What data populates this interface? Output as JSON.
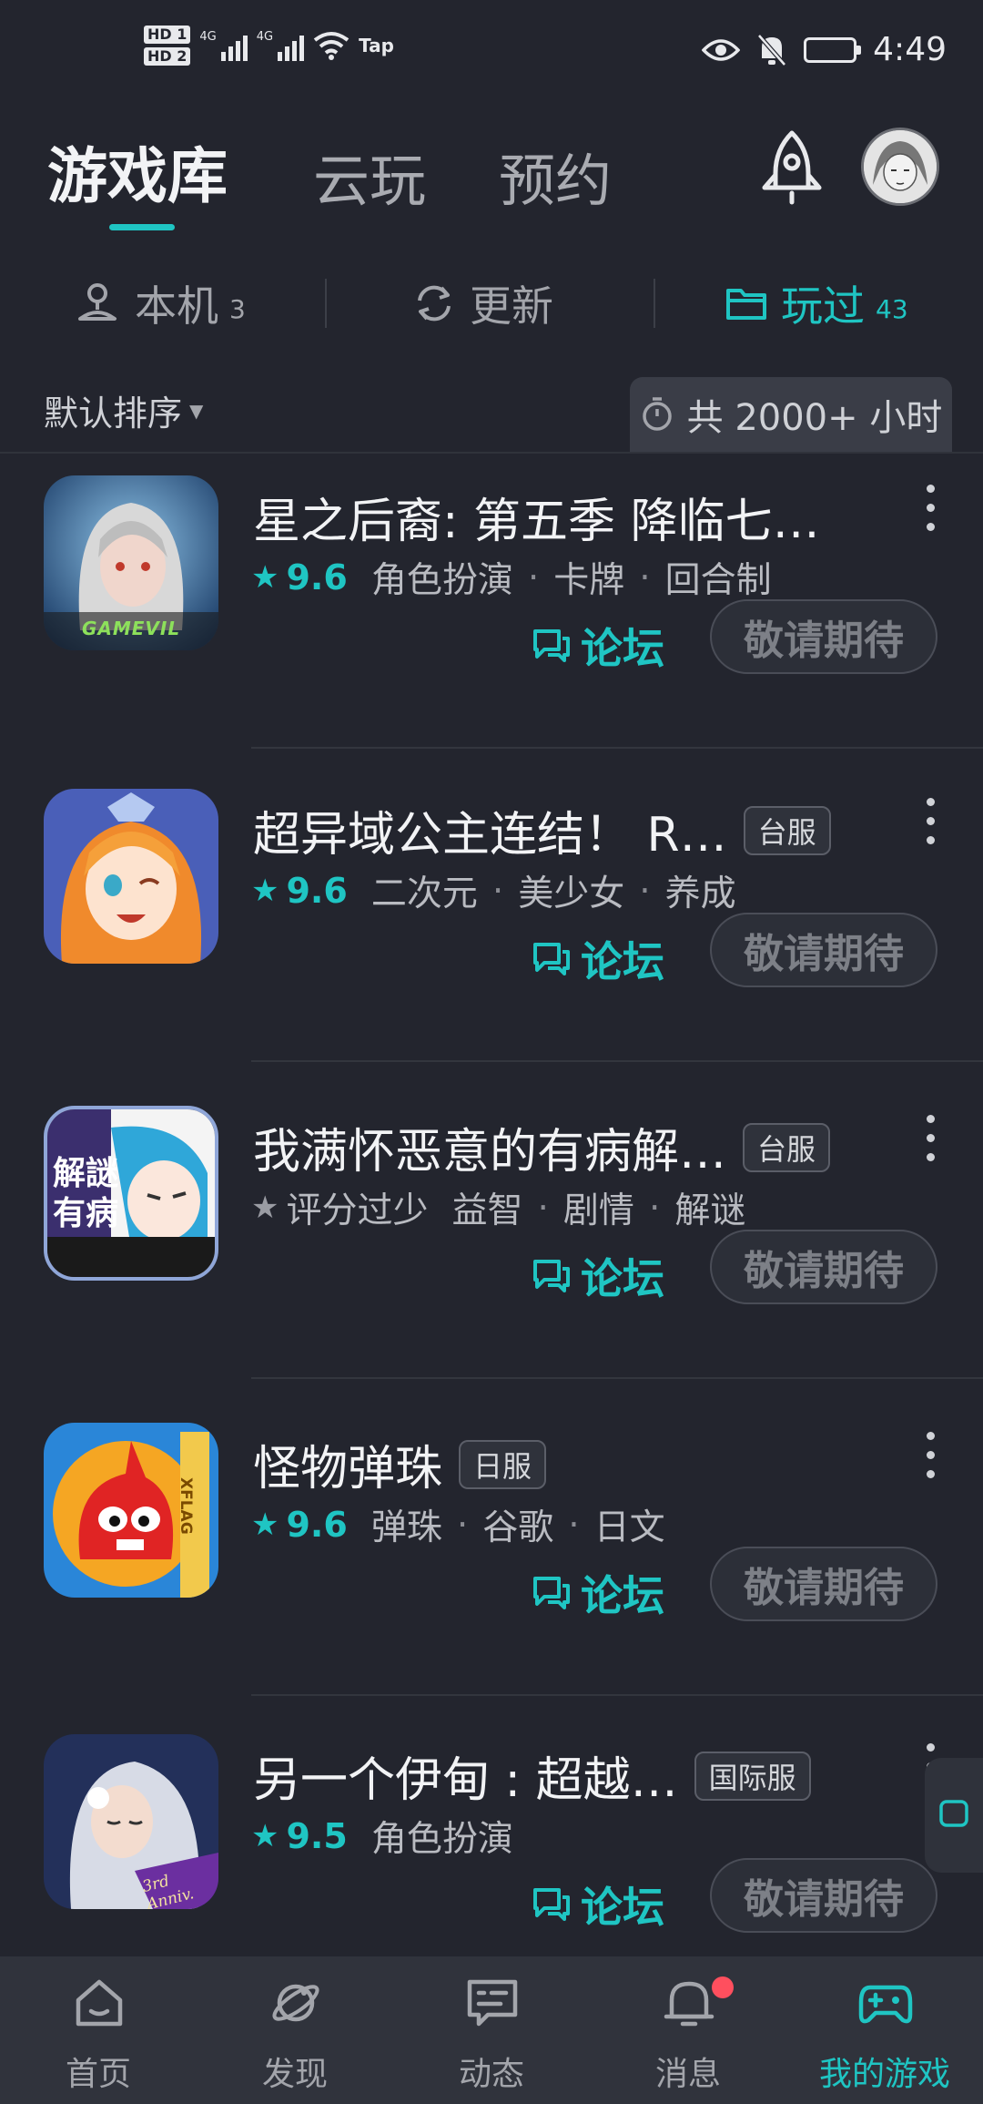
{
  "status_bar": {
    "hd1": "HD 1",
    "hd2": "HD 2",
    "net1": "4G",
    "net2": "4G",
    "app_indicator": "Tap",
    "time": "4:49"
  },
  "header": {
    "tabs": [
      {
        "label": "游戏库",
        "active": true
      },
      {
        "label": "云玩",
        "active": false
      },
      {
        "label": "预约",
        "active": false
      }
    ],
    "rocket_icon": "rocket-icon",
    "avatar": "avatar"
  },
  "subtabs": [
    {
      "label": "本机",
      "count": "3",
      "icon": "device-icon",
      "active": false
    },
    {
      "label": "更新",
      "count": "",
      "icon": "refresh-icon",
      "active": false
    },
    {
      "label": "玩过",
      "count": "43",
      "icon": "folder-icon",
      "active": true
    }
  ],
  "sort": {
    "label": "默认排序",
    "hours_label": "共 2000+ 小时"
  },
  "games": [
    {
      "title": "星之后裔: 第五季 降临七…",
      "badge": "",
      "has_rating": true,
      "rating": "9.6",
      "tags": [
        "角色扮演",
        "卡牌",
        "回合制"
      ],
      "forum": "论坛",
      "action": "敬请期待"
    },
    {
      "title": "超异域公主连结！ R…",
      "badge": "台服",
      "has_rating": true,
      "rating": "9.6",
      "tags": [
        "二次元",
        "美少女",
        "养成"
      ],
      "forum": "论坛",
      "action": "敬请期待"
    },
    {
      "title": "我满怀恶意的有病解…",
      "badge": "台服",
      "has_rating": false,
      "rating": "评分过少",
      "tags": [
        "益智",
        "剧情",
        "解谜"
      ],
      "forum": "论坛",
      "action": "敬请期待"
    },
    {
      "title": "怪物弹珠",
      "badge": "日服",
      "has_rating": true,
      "rating": "9.6",
      "tags": [
        "弹珠",
        "谷歌",
        "日文"
      ],
      "forum": "论坛",
      "action": "敬请期待"
    },
    {
      "title": "另一个伊甸 : 超越…",
      "badge": "国际服",
      "has_rating": true,
      "rating": "9.5",
      "tags": [
        "角色扮演"
      ],
      "forum": "论坛",
      "action": "敬请期待"
    }
  ],
  "icon_art": [
    {
      "caption": "GAMEVIL"
    },
    {
      "caption": ""
    },
    {
      "caption": "解謎 有病"
    },
    {
      "caption": "XFLAG"
    },
    {
      "caption": "3rd Anniv."
    }
  ],
  "bottom_nav": [
    {
      "label": "首页",
      "icon": "home-icon",
      "active": false
    },
    {
      "label": "发现",
      "icon": "planet-icon",
      "active": false
    },
    {
      "label": "动态",
      "icon": "chat-icon",
      "active": false
    },
    {
      "label": "消息",
      "icon": "bell-icon",
      "active": false,
      "unread": true
    },
    {
      "label": "我的游戏",
      "icon": "gamepad-icon",
      "active": true
    }
  ],
  "colors": {
    "background": "#23252e",
    "accent": "#1fc5c3",
    "nav_bg": "#30333c",
    "unread_dot": "#ff4f5e"
  }
}
